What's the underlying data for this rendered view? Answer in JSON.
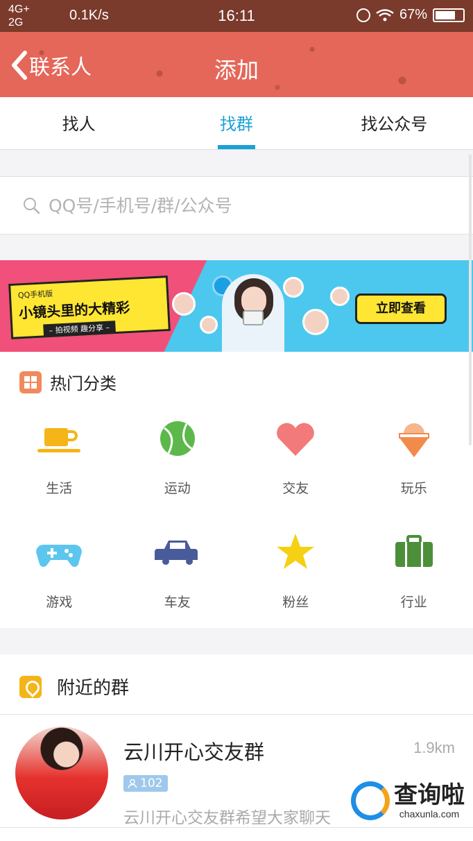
{
  "status_bar": {
    "network_top": "4G+",
    "network_bottom": "2G",
    "speed": "0.1K/s",
    "time": "16:11",
    "battery": "67%"
  },
  "header": {
    "back_label": "联系人",
    "title": "添加",
    "color": "#e4675a"
  },
  "tabs": [
    {
      "label": "找人",
      "active": false
    },
    {
      "label": "找群",
      "active": true
    },
    {
      "label": "找公众号",
      "active": false
    }
  ],
  "search": {
    "placeholder": "QQ号/手机号/群/公众号"
  },
  "banner": {
    "small_text": "QQ手机版",
    "headline": "小镜头里的大精彩",
    "subline": "– 拍视频 趣分享 –",
    "button": "立即查看"
  },
  "hot_categories": {
    "title": "热门分类",
    "items": [
      {
        "label": "生活",
        "icon": "cup-icon",
        "color": "#f5b417"
      },
      {
        "label": "运动",
        "icon": "tennis-ball-icon",
        "color": "#5cb84a"
      },
      {
        "label": "交友",
        "icon": "heart-icon",
        "color": "#f27a7a"
      },
      {
        "label": "玩乐",
        "icon": "ice-cream-icon",
        "color": "#f28a4a"
      },
      {
        "label": "游戏",
        "icon": "gamepad-icon",
        "color": "#5cc6ef"
      },
      {
        "label": "车友",
        "icon": "car-icon",
        "color": "#4a5b9a"
      },
      {
        "label": "粉丝",
        "icon": "star-icon",
        "color": "#f5d013"
      },
      {
        "label": "行业",
        "icon": "briefcase-icon",
        "color": "#4c8f3a"
      }
    ]
  },
  "nearby": {
    "title": "附近的群",
    "groups": [
      {
        "name": "云川开心交友群",
        "distance": "1.9km",
        "members": "102",
        "description": "云川开心交友群希望大家聊天"
      }
    ]
  },
  "watermark": {
    "cn": "查询啦",
    "en": "chaxunla.com"
  }
}
